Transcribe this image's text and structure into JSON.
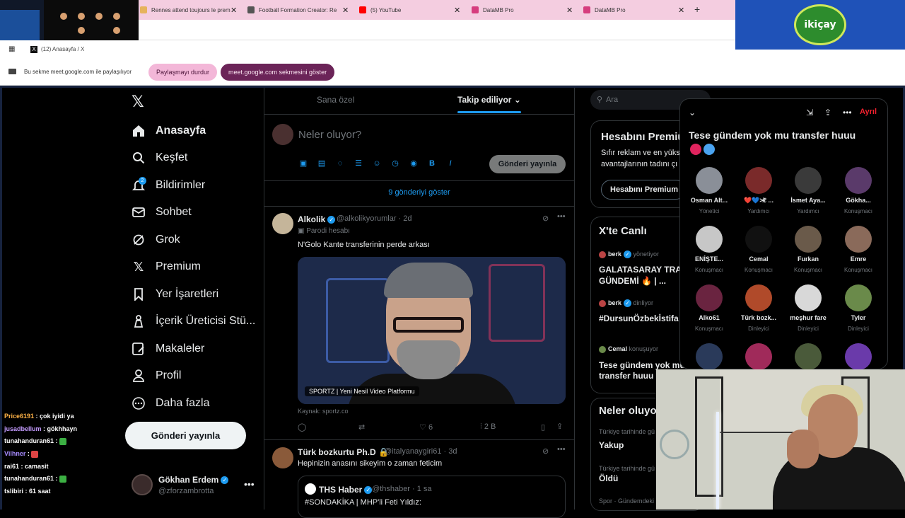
{
  "browser": {
    "tabs": [
      {
        "title": "Rennes attend toujours le prem",
        "color": "#e6b35c"
      },
      {
        "title": "Football Formation Creator: Re",
        "color": "#555"
      },
      {
        "title": "(5) YouTube",
        "color": "#ff0000"
      },
      {
        "title": "DataMB Pro",
        "color": "#d63d7e"
      },
      {
        "title": "DataMB Pro",
        "color": "#d63d7e"
      }
    ],
    "window_title": "(12) Anasayfa / X",
    "share_text": "Bu sekme meet.google.com ile paylaşılıyor",
    "stop_sharing": "Paylaşmayı durdur",
    "show_tab": "meet.google.com sekmesini göster"
  },
  "brand_logo": "ikiçay",
  "nav": {
    "items": [
      {
        "label": "Anasayfa",
        "icon": "home-icon"
      },
      {
        "label": "Keşfet",
        "icon": "search-icon"
      },
      {
        "label": "Bildirimler",
        "icon": "bell-icon",
        "badge": "2"
      },
      {
        "label": "Sohbet",
        "icon": "mail-icon"
      },
      {
        "label": "Grok",
        "icon": "grok-icon"
      },
      {
        "label": "Premium",
        "icon": "x-icon"
      },
      {
        "label": "Yer İşaretleri",
        "icon": "bookmark-icon"
      },
      {
        "label": "İçerik Üreticisi Stü...",
        "icon": "creator-icon"
      },
      {
        "label": "Makaleler",
        "icon": "article-icon"
      },
      {
        "label": "Profil",
        "icon": "user-icon"
      },
      {
        "label": "Daha fazla",
        "icon": "more-icon"
      }
    ],
    "post_button": "Gönderi yayınla",
    "me": {
      "name": "Gökhan Erdem",
      "handle": "@zforzambrotta"
    }
  },
  "timeline": {
    "tab_foryou": "Sana özel",
    "tab_following": "Takip ediliyor",
    "compose_placeholder": "Neler oluyor?",
    "compose_button": "Gönderi yayınla",
    "show_more": "9 gönderiyi göster",
    "post1": {
      "name": "Alkolik",
      "handle": "@alkolikyorumlar · 2d",
      "parody": "Parodi hesabı",
      "text": "N'Golo Kante transferinin perde arkası",
      "media_caption": "SPORTZ | Yeni Nesil Video Platformu",
      "source": "Kaynak: sportz.co",
      "likes": "6",
      "views": "2 B"
    },
    "post2": {
      "name": "Türk bozkurtu Ph.D",
      "handle": "@italyanaygiri61 · 3d",
      "text": "Hepinizin anasını sikeyim o zaman feticim",
      "quote_name": "THS Haber",
      "quote_handle": "@thshaber · 1 sa",
      "quote_text": "#SONDAKİKA | MHP'li Feti Yıldız:"
    }
  },
  "right": {
    "search_placeholder": "Ara",
    "premium_title": "Hesabını Premiu",
    "premium_text1": "Sıfır reklam ve en yüks",
    "premium_text2": "avantajlarının tadını çı",
    "premium_button": "Hesabını Premium",
    "live_title": "X'te Canlı",
    "live": [
      {
        "user": "berk",
        "status": "yönetiyor",
        "title1": "GALATASARAY TRANS",
        "title2": "GÜNDEMİ 🔥 | ..."
      },
      {
        "user": "berk",
        "status": "dinliyor",
        "title1": "#DursunÖzbekİstifa",
        "title2": ""
      },
      {
        "user": "Cemal",
        "status": "konuşuyor",
        "title1": "Tese gündem yok mu",
        "title2": "transfer huuu"
      }
    ],
    "whats_title": "Neler oluyo",
    "trends": [
      {
        "meta": "Türkiye tarihinde gü",
        "name": "Yakup"
      },
      {
        "meta": "Türkiye tarihinde gü",
        "name": "Öldü"
      },
      {
        "meta": "Spor · Gündemdeki",
        "name": ""
      }
    ]
  },
  "space": {
    "title": "Tese gündem yok mu transfer huuu",
    "leave": "Ayrıl",
    "speakers": [
      {
        "name": "Osman Alt...",
        "role": "Yönetici",
        "color": "#8a8f98"
      },
      {
        "name": "❤️💙≯ℓ ...",
        "role": "Yardımcı",
        "color": "#7a2a2a"
      },
      {
        "name": "İsmet Aya...",
        "role": "Yardımcı",
        "color": "#3a3a3a"
      },
      {
        "name": "Gökha...",
        "role": "Konuşmacı",
        "color": "#5a3a6a"
      },
      {
        "name": "ENİŞTE...",
        "role": "Konuşmacı",
        "color": "#c7c7c7"
      },
      {
        "name": "Cemal",
        "role": "Konuşmacı",
        "color": "#111111"
      },
      {
        "name": "Furkan",
        "role": "Konuşmacı",
        "color": "#6a5a4a"
      },
      {
        "name": "Emre",
        "role": "Konuşmacı",
        "color": "#8a6a5a"
      },
      {
        "name": "Alko61",
        "role": "Konuşmacı",
        "color": "#6a2440"
      },
      {
        "name": "Türk bozk...",
        "role": "Dinleyici",
        "color": "#b04a2a"
      },
      {
        "name": "meşhur fare",
        "role": "Dinleyici",
        "color": "#d8d8d8"
      },
      {
        "name": "Tyler",
        "role": "Dinleyici",
        "color": "#6a8a4a"
      },
      {
        "name": "",
        "role": "",
        "color": "#2a3a5a"
      },
      {
        "name": "",
        "role": "",
        "color": "#a02a5a"
      },
      {
        "name": "",
        "role": "",
        "color": "#4a5a3a"
      },
      {
        "name": "",
        "role": "",
        "color": "#6a3aaa"
      }
    ]
  },
  "chat": [
    {
      "user": "Price6191",
      "msg": "çok iyidi ya",
      "color": "#ffb347"
    },
    {
      "user": "jusadbellum",
      "msg": "gökhhayn",
      "color": "#c49bff"
    },
    {
      "user": "tunahanduran61",
      "msg": "",
      "color": "#ffffff",
      "emote": "#3cb043"
    },
    {
      "user": "Vilhner",
      "msg": "",
      "color": "#a78bff",
      "emote": "#d44"
    },
    {
      "user": "rai61",
      "msg": "camasit",
      "color": "#ffffff"
    },
    {
      "user": "tunahanduran61",
      "msg": "",
      "color": "#ffffff",
      "emote": "#3cb043"
    },
    {
      "user": "tslibiri",
      "msg": "61 saat",
      "color": "#ffffff"
    }
  ]
}
